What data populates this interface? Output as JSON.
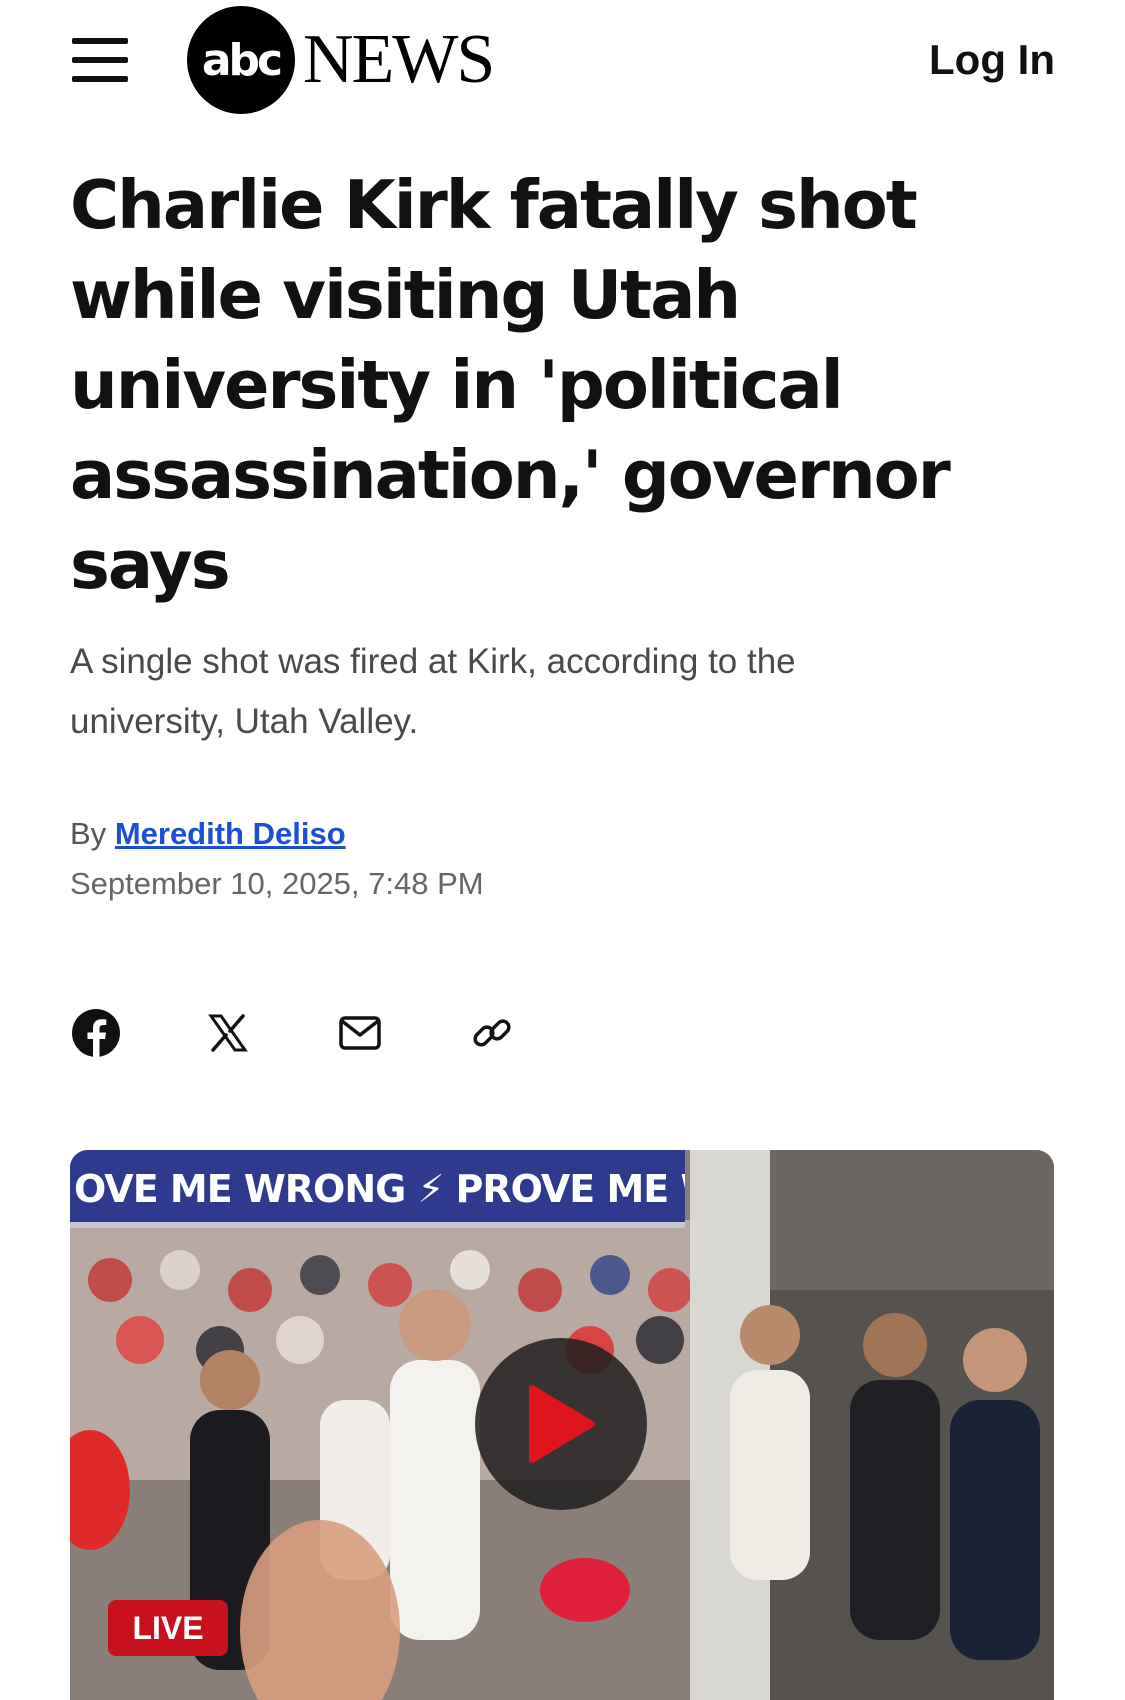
{
  "header": {
    "logo_abc": "abc",
    "logo_news": "NEWS",
    "login_label": "Log In"
  },
  "article": {
    "headline": "Charlie Kirk fatally shot while visiting Utah university in 'political assassination,' governor says",
    "dek": "A single shot was fired at Kirk, according to the university, Utah Valley.",
    "byline_prefix": "By",
    "author": "Meredith Deliso",
    "date": "September 10, 2025, 7:48 PM"
  },
  "share": {
    "icons": [
      "facebook-icon",
      "x-icon",
      "email-icon",
      "link-icon"
    ]
  },
  "media": {
    "banner_text": "OVE ME WRONG ⚡ PROVE ME WRONG",
    "live_label": "LIVE",
    "play_icon": "play-icon"
  },
  "colors": {
    "author_link": "#1a4fd6",
    "live_badge": "#c8101e",
    "play_triangle": "#e0141f",
    "banner": "#2f3a8f"
  }
}
